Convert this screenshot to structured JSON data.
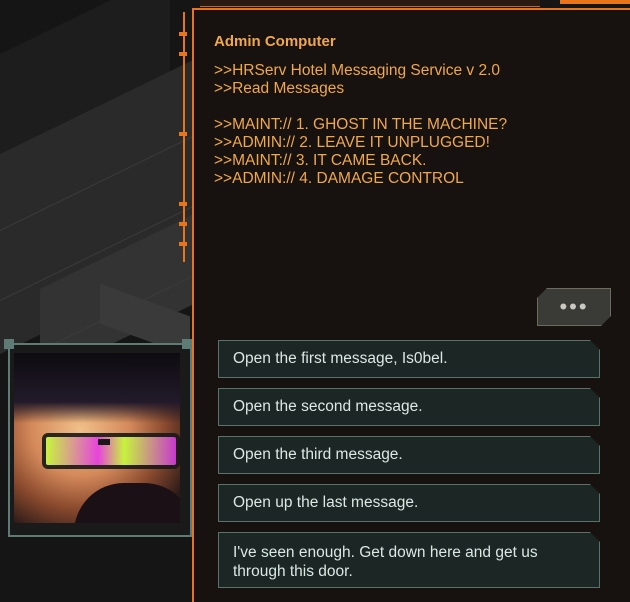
{
  "terminal": {
    "title": "Admin Computer",
    "header_lines": [
      ">>HRServ Hotel Messaging Service v 2.0",
      ">>Read Messages"
    ],
    "messages": [
      ">>MAINT:// 1. GHOST IN THE MACHINE?",
      ">>ADMIN:// 2. LEAVE IT UNPLUGGED!",
      ">>MAINT:// 3. IT CAME BACK.",
      ">>ADMIN:// 4. DAMAGE CONTROL"
    ]
  },
  "more_button": {
    "label": "•••"
  },
  "choices": [
    "Open the first message, Is0bel.",
    "Open the second message.",
    "Open the third message.",
    "Open up the last message.",
    "I've seen enough. Get down here and get us through this door."
  ],
  "colors": {
    "accent_orange": "#e8741c",
    "terminal_text": "#f0a84a",
    "choice_border": "#59716a",
    "choice_text": "#dbe8e4"
  }
}
